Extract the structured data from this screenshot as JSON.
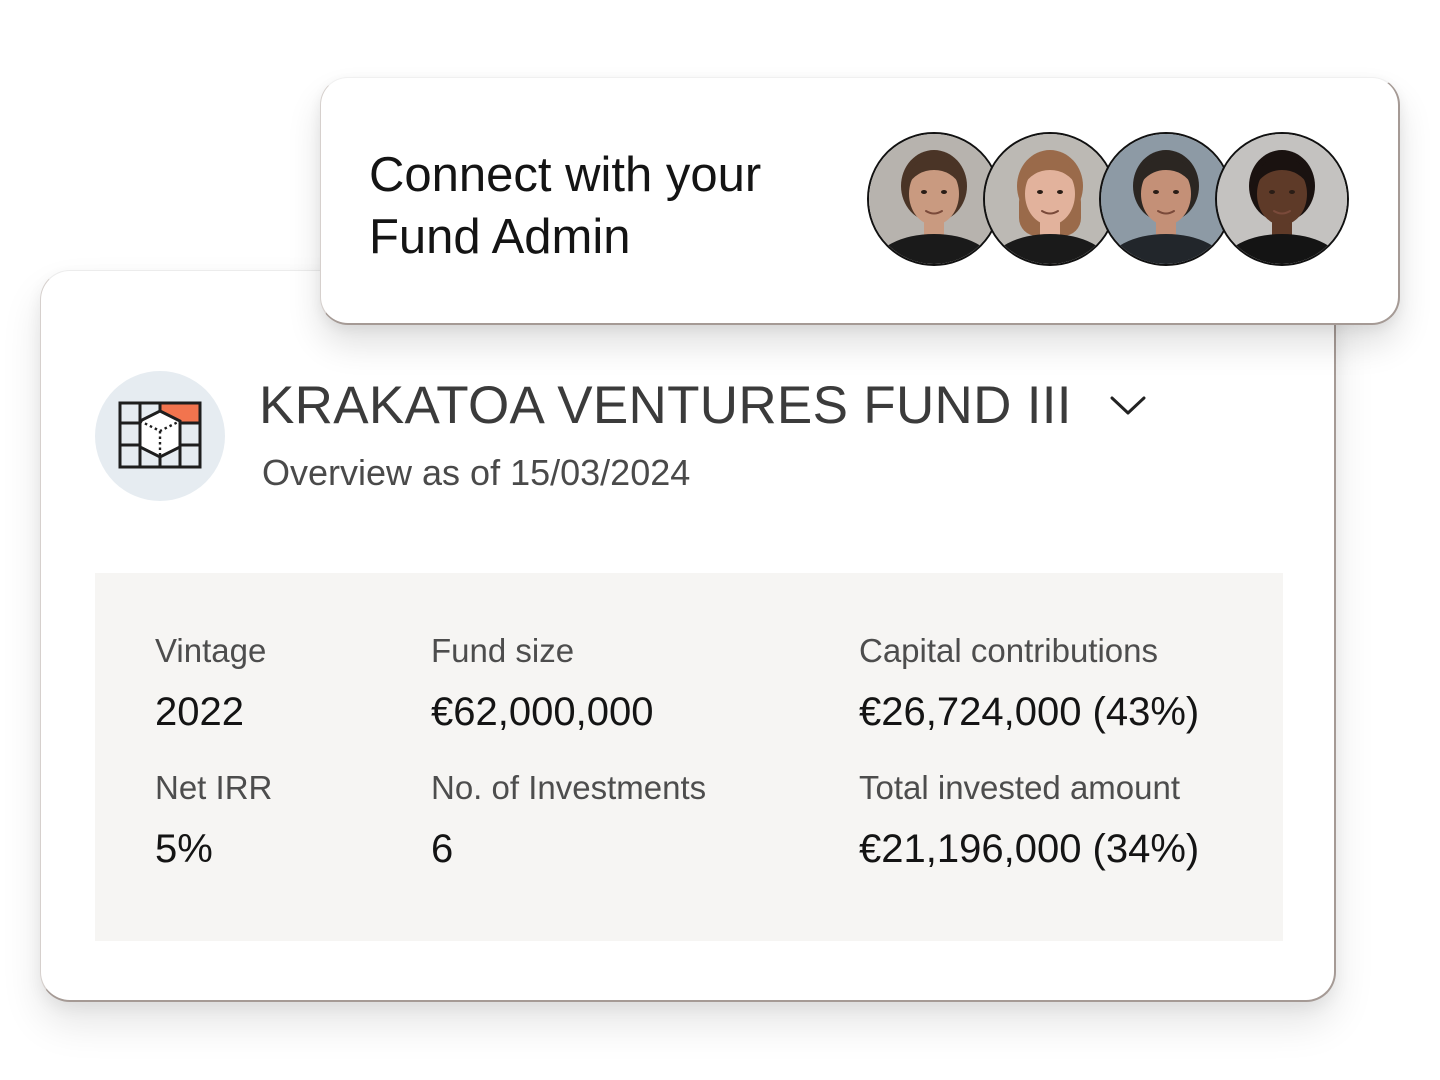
{
  "connect": {
    "line1": "Connect with your",
    "line2": "Fund Admin",
    "avatars": [
      {
        "name": "avatar-admin-1",
        "skin": "#c99a80",
        "hair": "#4a3426",
        "bg": "#b7b3ae",
        "shirt": "#1a1a1a"
      },
      {
        "name": "avatar-admin-2",
        "skin": "#e2b29c",
        "hair": "#9a6a4a",
        "bg": "#bcb9b4",
        "shirt": "#1a1a1a"
      },
      {
        "name": "avatar-admin-3",
        "skin": "#c49077",
        "hair": "#2b2622",
        "bg": "#8d9aa5",
        "shirt": "#22262b"
      },
      {
        "name": "avatar-admin-4",
        "skin": "#5e3a28",
        "hair": "#1a1210",
        "bg": "#c4c2c0",
        "shirt": "#141414"
      }
    ]
  },
  "fund": {
    "title": "KRAKATOA VENTURES FUND III",
    "subtitle": "Overview as of 15/03/2024",
    "logo_accent": "#f2744e",
    "stats": {
      "vintage": {
        "label": "Vintage",
        "value": "2022"
      },
      "fund_size": {
        "label": "Fund size",
        "value": "€62,000,000"
      },
      "capital_contributions": {
        "label": "Capital contributions",
        "value": "€26,724,000 (43%)"
      },
      "net_irr": {
        "label": "Net IRR",
        "value": "5%"
      },
      "investments": {
        "label": "No. of Investments",
        "value": "6"
      },
      "total_invested": {
        "label": "Total invested amount",
        "value": "€21,196,000 (34%)"
      }
    }
  }
}
